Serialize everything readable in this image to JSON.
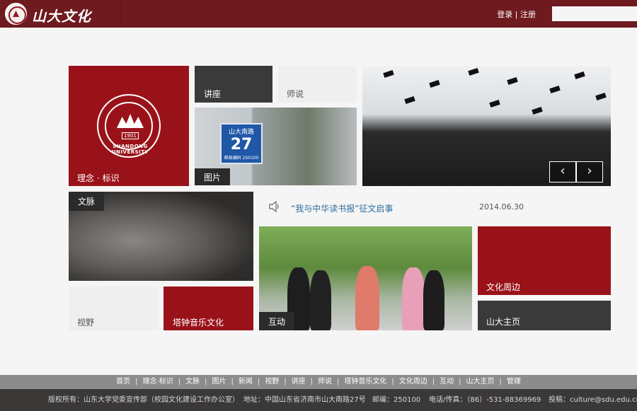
{
  "header": {
    "logo_text": "山大文化",
    "login": "登录",
    "divider": "|",
    "register": "注册",
    "search_placeholder": ""
  },
  "emblem": {
    "year": "1901",
    "university": "SHANDONG UNIVERSITY"
  },
  "tiles": {
    "identity": "理念 · 标识",
    "lecture": "讲座",
    "teacher_talk": "师说",
    "photos": "图片",
    "culture_vein": "文脉",
    "vision": "视野",
    "bell_tower_music": "塔钟音乐文化",
    "interaction": "互动",
    "culture_around": "文化周边",
    "sdu_home": "山大主页"
  },
  "sign": {
    "line1": "山大南路",
    "number": "27",
    "postcode": "邮政编码 250100"
  },
  "slider": {
    "prev": "‹",
    "next": "›"
  },
  "notice": {
    "icon": "speaker-icon",
    "title": "“我与中华读书报”征文启事",
    "date": "2014.06.30"
  },
  "footer_nav": [
    "首页",
    "理念·标识",
    "文脉",
    "图片",
    "新闻",
    "视野",
    "讲座",
    "师说",
    "塔钟音乐文化",
    "文化周边",
    "互动",
    "山大主页",
    "管理"
  ],
  "footer_info": {
    "copyright": "版权所有：山东大学党委宣传部（校园文化建设工作办公室）",
    "address": "地址：中国山东省济南市山大南路27号",
    "postcode": "邮编：250100",
    "phone": "电话/传真：（86）-531-88369969",
    "email": "投稿：culture@sdu.edu.cn"
  },
  "colors": {
    "header_bg": "#6e1a1e",
    "tile_red": "#9a1219",
    "tile_dark": "#3a3a3a",
    "tile_light": "#efefef",
    "link_blue": "#2f6fa0"
  }
}
